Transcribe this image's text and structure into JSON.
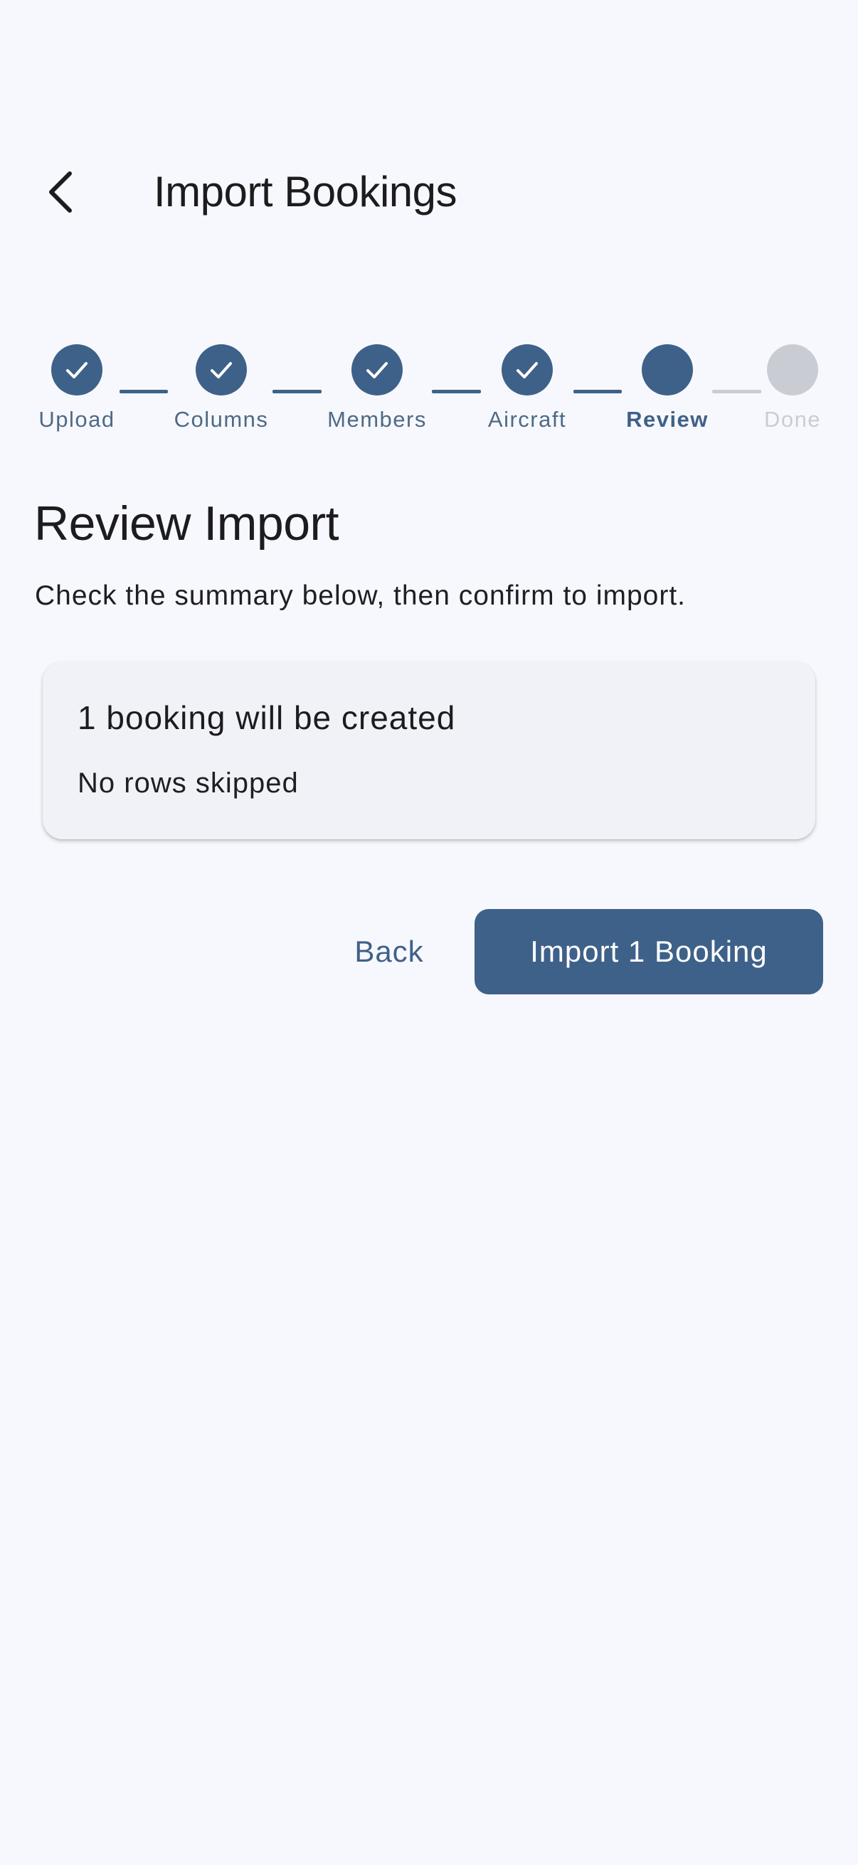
{
  "app_bar": {
    "title": "Import Bookings",
    "back_icon": "chevron-left-icon"
  },
  "stepper": {
    "colors": {
      "completed": "#3e6189",
      "current": "#3e6189",
      "upcoming": "#c9cdd3",
      "label_completed": "#4e6a86",
      "label_current": "#3e6189",
      "label_upcoming": "#c9cdd3"
    },
    "steps": [
      {
        "label": "Upload",
        "state": "completed"
      },
      {
        "label": "Columns",
        "state": "completed"
      },
      {
        "label": "Members",
        "state": "completed"
      },
      {
        "label": "Aircraft",
        "state": "completed"
      },
      {
        "label": "Review",
        "state": "current"
      },
      {
        "label": "Done",
        "state": "upcoming"
      }
    ]
  },
  "content": {
    "title": "Review Import",
    "description": "Check the summary below, then confirm to import."
  },
  "summary": {
    "headline": "1 booking will be created",
    "subtext": "No rows skipped"
  },
  "actions": {
    "back_label": "Back",
    "import_label": "Import 1 Booking"
  }
}
